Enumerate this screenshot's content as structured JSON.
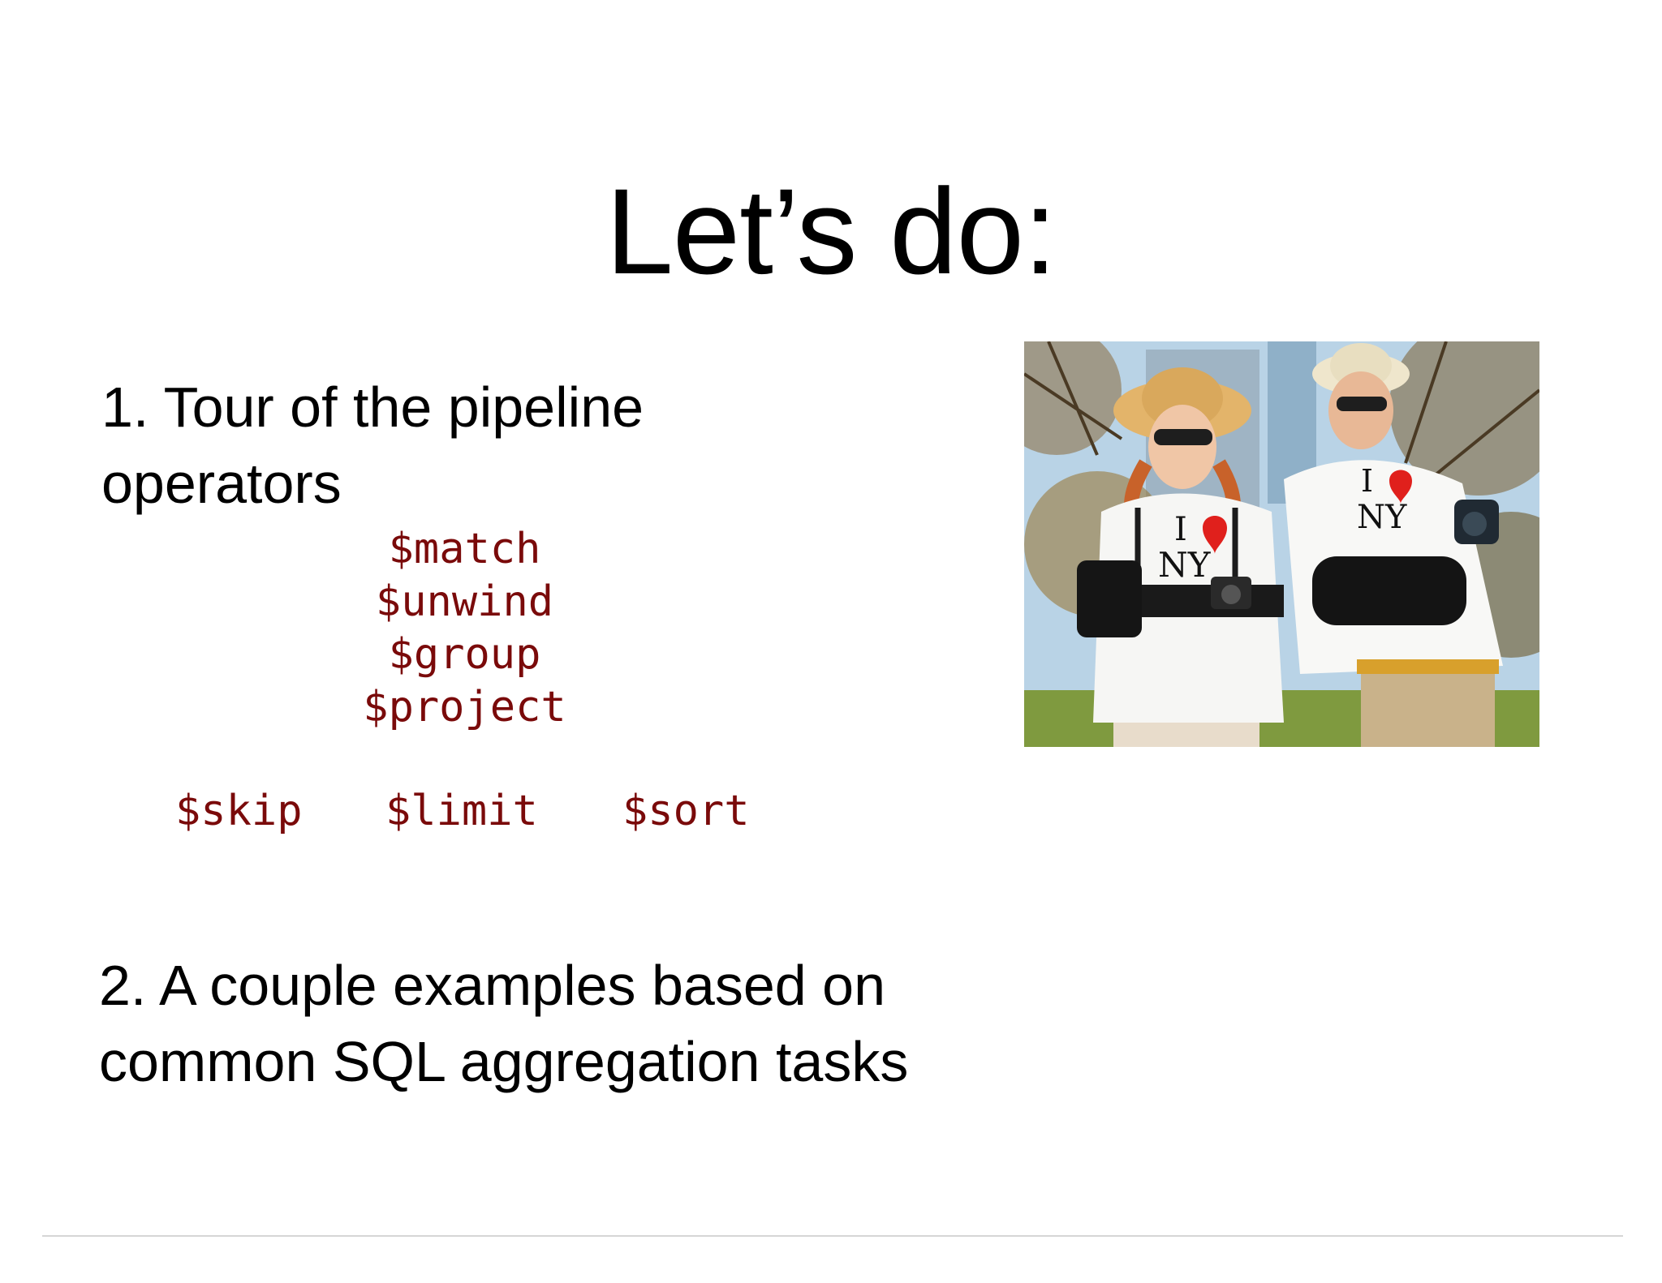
{
  "slide": {
    "title": "Let’s do:",
    "item1": {
      "text": "1. Tour of the pipeline\noperators",
      "operators_stack": [
        "$match",
        "$unwind",
        "$group",
        "$project"
      ],
      "operators_row": [
        "$skip",
        "$limit",
        "$sort"
      ]
    },
    "item2": {
      "text": "2.  A couple examples based on\ncommon SQL aggregation tasks"
    },
    "photo": {
      "shirt_text_top": "I",
      "shirt_text_bottom": "NY"
    }
  },
  "colors": {
    "code": "#7a0a0a",
    "heart": "#e0201c",
    "rule": "#d6d6d6"
  }
}
